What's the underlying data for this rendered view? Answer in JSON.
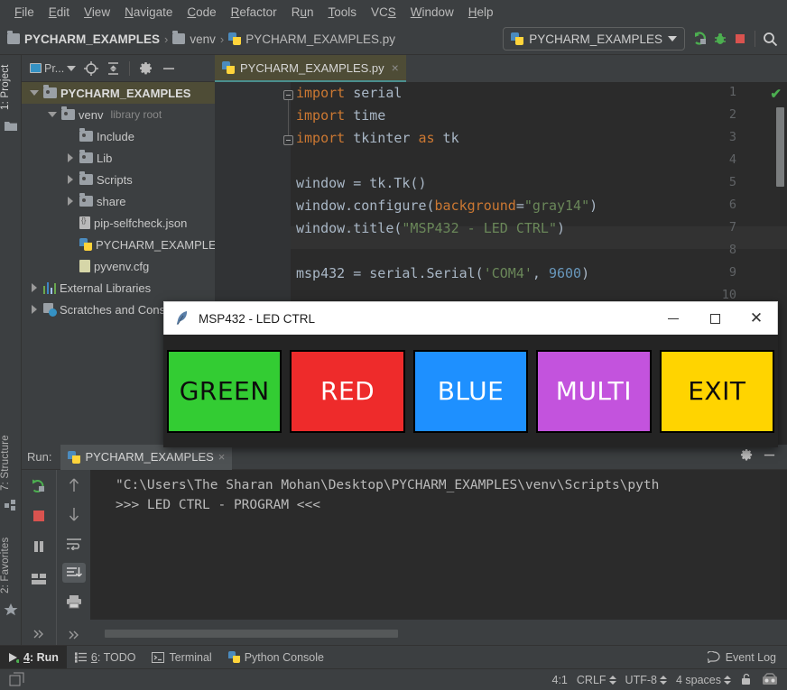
{
  "menubar": {
    "items": [
      {
        "label": "File",
        "mnemonic": "F"
      },
      {
        "label": "Edit",
        "mnemonic": "E"
      },
      {
        "label": "View",
        "mnemonic": "V"
      },
      {
        "label": "Navigate",
        "mnemonic": "N"
      },
      {
        "label": "Code",
        "mnemonic": "C"
      },
      {
        "label": "Refactor",
        "mnemonic": "R"
      },
      {
        "label": "Run",
        "mnemonic": "R"
      },
      {
        "label": "Tools",
        "mnemonic": "T"
      },
      {
        "label": "VCS",
        "mnemonic": "S"
      },
      {
        "label": "Window",
        "mnemonic": "W"
      },
      {
        "label": "Help",
        "mnemonic": "H"
      }
    ]
  },
  "navbar": {
    "breadcrumbs": [
      "PYCHARM_EXAMPLES",
      "venv",
      "PYCHARM_EXAMPLES.py"
    ],
    "separator": "›",
    "run_config": "PYCHARM_EXAMPLES",
    "icons": [
      "run-icon",
      "debug-icon",
      "stop-icon",
      "search-icon"
    ]
  },
  "left_rail": {
    "top_tab": "1: Project",
    "bottom_tabs": [
      "7: Structure",
      "2: Favorites"
    ]
  },
  "project_panel": {
    "toolbar": {
      "view_label": "Pr...",
      "icons": [
        "locate-icon",
        "collapse-all-icon",
        "gear-icon",
        "hide-icon"
      ]
    },
    "tree": [
      {
        "label": "PYCHARM_EXAMPLES",
        "note": "",
        "icon": "folder-icon",
        "twisty": "down",
        "indent": 0,
        "bold": true,
        "selected": true
      },
      {
        "label": "venv",
        "note": "library root",
        "icon": "folder-icon",
        "twisty": "down",
        "indent": 1,
        "bold": false,
        "selected": false
      },
      {
        "label": "Include",
        "note": "",
        "icon": "folder-icon",
        "twisty": "none",
        "indent": 2,
        "bold": false,
        "selected": false
      },
      {
        "label": "Lib",
        "note": "",
        "icon": "folder-icon",
        "twisty": "right",
        "indent": 2,
        "bold": false,
        "selected": false
      },
      {
        "label": "Scripts",
        "note": "",
        "icon": "folder-icon",
        "twisty": "right",
        "indent": 2,
        "bold": false,
        "selected": false
      },
      {
        "label": "share",
        "note": "",
        "icon": "folder-icon",
        "twisty": "right",
        "indent": 2,
        "bold": false,
        "selected": false
      },
      {
        "label": "pip-selfcheck.json",
        "note": "",
        "icon": "json-file-icon",
        "twisty": "none",
        "indent": 2,
        "bold": false,
        "selected": false
      },
      {
        "label": "PYCHARM_EXAMPLES.py",
        "note": "",
        "icon": "python-file-icon",
        "twisty": "none",
        "indent": 2,
        "bold": false,
        "selected": false
      },
      {
        "label": "pyvenv.cfg",
        "note": "",
        "icon": "cfg-file-icon",
        "twisty": "none",
        "indent": 2,
        "bold": false,
        "selected": false
      },
      {
        "label": "External Libraries",
        "note": "",
        "icon": "library-icon",
        "twisty": "right",
        "indent": 0,
        "bold": false,
        "selected": false
      },
      {
        "label": "Scratches and Consoles",
        "note": "",
        "icon": "scratch-icon",
        "twisty": "right",
        "indent": 0,
        "bold": false,
        "selected": false
      }
    ]
  },
  "editor": {
    "tab_label": "PYCHARM_EXAMPLES.py",
    "close_glyph": "×",
    "inspection_status": "✔",
    "lines": [
      {
        "num": "1",
        "tokens": [
          {
            "t": "import",
            "c": "kw"
          },
          {
            "t": " serial",
            "c": "id"
          }
        ]
      },
      {
        "num": "2",
        "tokens": [
          {
            "t": "import",
            "c": "kw"
          },
          {
            "t": " time",
            "c": "id"
          }
        ]
      },
      {
        "num": "3",
        "tokens": [
          {
            "t": "import",
            "c": "kw"
          },
          {
            "t": " tkinter ",
            "c": "id"
          },
          {
            "t": "as",
            "c": "kw"
          },
          {
            "t": " tk",
            "c": "id"
          }
        ]
      },
      {
        "num": "4",
        "tokens": []
      },
      {
        "num": "5",
        "tokens": [
          {
            "t": "window = tk.Tk()",
            "c": "id"
          }
        ]
      },
      {
        "num": "6",
        "tokens": [
          {
            "t": "window.configure(",
            "c": "id"
          },
          {
            "t": "background",
            "c": "attr"
          },
          {
            "t": "=",
            "c": "id"
          },
          {
            "t": "\"gray14\"",
            "c": "str"
          },
          {
            "t": ")",
            "c": "id"
          }
        ]
      },
      {
        "num": "7",
        "tokens": [
          {
            "t": "window.title(",
            "c": "id"
          },
          {
            "t": "\"MSP432 - LED CTRL\"",
            "c": "str"
          },
          {
            "t": ")",
            "c": "id"
          }
        ]
      },
      {
        "num": "8",
        "tokens": []
      },
      {
        "num": "9",
        "tokens": [
          {
            "t": "msp432 = serial.Serial(",
            "c": "id"
          },
          {
            "t": "'COM4'",
            "c": "str"
          },
          {
            "t": ", ",
            "c": "id"
          },
          {
            "t": "9600",
            "c": "num"
          },
          {
            "t": ")",
            "c": "id"
          }
        ]
      },
      {
        "num": "10",
        "tokens": []
      }
    ]
  },
  "tk_window": {
    "title": "MSP432 - LED CTRL",
    "icon": "feather-icon",
    "minimize_glyph": "–",
    "maximize_glyph": "□",
    "close_glyph": "✕",
    "background": "#242424",
    "buttons": [
      {
        "label": "GREEN",
        "bg": "#33cc33",
        "fg": "#0d0d0d"
      },
      {
        "label": "RED",
        "bg": "#ee2b2b",
        "fg": "#ffffff"
      },
      {
        "label": "BLUE",
        "bg": "#1e90ff",
        "fg": "#ffffff"
      },
      {
        "label": "MULTI",
        "bg": "#c353dd",
        "fg": "#ffffff"
      },
      {
        "label": "EXIT",
        "bg": "#ffd400",
        "fg": "#0d0d0d"
      }
    ]
  },
  "run_panel": {
    "label": "Run:",
    "tab_label": "PYCHARM_EXAMPLES",
    "tab_close": "×",
    "header_icons": [
      "gear-icon",
      "hide-icon"
    ],
    "tool_icons_left": [
      "rerun-icon",
      "stop-icon",
      "pause-icon",
      "layout-icon",
      "more-icon"
    ],
    "tool_icons_right": [
      "up-arrow-icon",
      "down-arrow-icon",
      "soft-wrap-icon",
      "scroll-to-end-icon",
      "print-icon",
      "more-icon"
    ],
    "console_lines": [
      "\"C:\\Users\\The Sharan Mohan\\Desktop\\PYCHARM_EXAMPLES\\venv\\Scripts\\pyth",
      ">>> LED CTRL - PROGRAM <<<"
    ]
  },
  "bottom_tabs": [
    {
      "label": "4: Run",
      "mnemonic": "4",
      "icon": "run-icon",
      "active": true
    },
    {
      "label": "6: TODO",
      "mnemonic": "6",
      "icon": "todo-icon",
      "active": false
    },
    {
      "label": "Terminal",
      "mnemonic": "",
      "icon": "terminal-icon",
      "active": false
    },
    {
      "label": "Python Console",
      "mnemonic": "",
      "icon": "python-icon",
      "active": false
    }
  ],
  "event_log": {
    "label": "Event Log",
    "icon": "balloon-icon"
  },
  "statusbar": {
    "left_icon": "toggle-toolbars-icon",
    "caret": "4:1",
    "line_separator": "CRLF",
    "encoding": "UTF-8",
    "indent": "4 spaces",
    "lock_icon": "unlocked-icon",
    "inspection_icon": "inspector-icon"
  }
}
